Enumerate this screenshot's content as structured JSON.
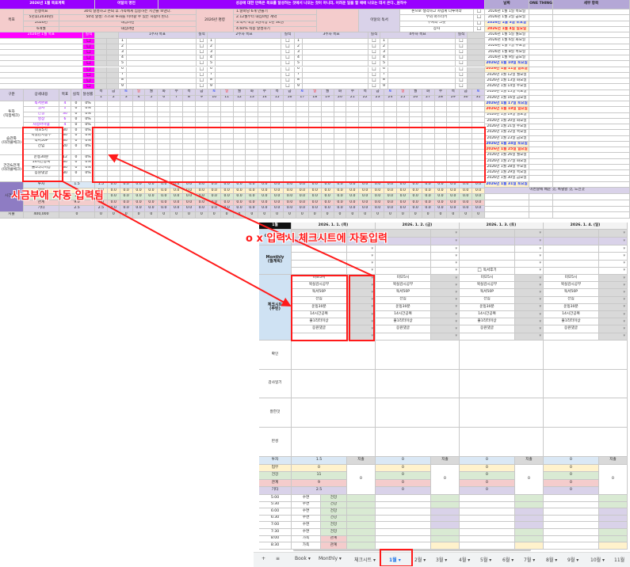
{
  "header": {
    "title": "2026년 1월 목표계획",
    "quote_label": "이달의 명언",
    "quote": "성공에 대한 만족은 목표를 달성하는 것에서 나오는 것이 아니라, 어려운 일을 할 때에 나오는 데서 온다._원작수"
  },
  "goals": {
    "label": "목표",
    "rows": [
      {
        "label": "인생목표",
        "value": "30억 달성하고 은퇴 후 가족에게 집중하는 시간을 보낸다."
      },
      {
        "label": "5년후(2030년)",
        "value": "50억 달성: 스스로 투자를 이어갈 수 있는 사람이 된다."
      },
      {
        "label": "2026년",
        "value": "내집마련"
      },
      {
        "label": "6개월",
        "value": "내집마련"
      }
    ],
    "command_label": "2026년 명령",
    "commands": [
      "1.달마당 6개 만들기",
      "2.12월부터 내집마련 계약",
      "3.독서 책발 3권이상 1년 36권",
      "4.60% 적용 달성하기"
    ],
    "reading_label": "이달의 독서",
    "books": [
      "돈으로 생각하고 사업계 다루어라",
      "부의 마스터키",
      "부자의 그릇",
      "장사"
    ]
  },
  "weekly": {
    "month_goal_label": "2026년 1월 목표",
    "result_label": "실적",
    "weeks": [
      "1주차 목표",
      "2주차 목표",
      "3주차 목표",
      "4주차 목표"
    ],
    "numbers": [
      "1",
      "2",
      "3",
      "4",
      "5",
      "6",
      "7",
      "8",
      "9"
    ]
  },
  "tracker": {
    "headers": [
      "구분",
      "상세내용",
      "목표",
      "실적",
      "달성률"
    ],
    "dow": [
      "목",
      "금",
      "토",
      "일",
      "월",
      "화",
      "수",
      "목",
      "금",
      "토",
      "일",
      "월",
      "화",
      "수",
      "목",
      "금",
      "토",
      "일",
      "월",
      "화",
      "수",
      "목",
      "금",
      "토",
      "일",
      "월",
      "화",
      "수",
      "목",
      "금",
      "토"
    ],
    "days": [
      "1",
      "2",
      "3",
      "4",
      "5",
      "6",
      "7",
      "8",
      "9",
      "10",
      "11",
      "12",
      "13",
      "14",
      "15",
      "16",
      "17",
      "18",
      "19",
      "20",
      "21",
      "22",
      "23",
      "24",
      "25",
      "26",
      "27",
      "28",
      "29",
      "30",
      "31"
    ],
    "groups": [
      {
        "label": "투자\n(직접체크)",
        "items": [
          {
            "name": "독서완료",
            "goal": "4",
            "actual": "0",
            "rate": "0%"
          },
          {
            "name": "필사",
            "goal": "1",
            "actual": "0",
            "rate": "0%"
          },
          {
            "name": "연필",
            "goal": "30",
            "actual": "0",
            "rate": "0%"
          },
          {
            "name": "영상",
            "goal": "6",
            "actual": "0",
            "rate": "0%"
          },
          {
            "name": "사업아이템",
            "goal": "4",
            "actual": "0",
            "rate": "0%"
          }
        ]
      },
      {
        "label": "습관화\n(미라클체크)",
        "items": [
          {
            "name": "미모5시",
            "goal": "30",
            "actual": "0",
            "rate": "0%"
          },
          {
            "name": "묵실감시공부",
            "goal": "30",
            "actual": "0",
            "rate": "0%"
          },
          {
            "name": "독서50P",
            "goal": "30",
            "actual": "0",
            "rate": "0%"
          },
          {
            "name": "전임",
            "goal": "20",
            "actual": "0",
            "rate": "0%"
          }
        ]
      },
      {
        "label": "건강&관계\n(미라클체크)",
        "items": [
          {
            "name": "운동30분",
            "goal": "12",
            "actual": "0",
            "rate": "0%"
          },
          {
            "name": "14시간공복",
            "goal": "30",
            "actual": "0",
            "rate": "0%"
          },
          {
            "name": "물1리터이상",
            "goal": "30",
            "actual": "0",
            "rate": "0%"
          },
          {
            "name": "응원댓글",
            "goal": "30",
            "actual": "0",
            "rate": "0%"
          }
        ]
      }
    ]
  },
  "summary": {
    "label": "시간관리",
    "rows": [
      {
        "label": "투자",
        "total": "1.5",
        "daily": [
          "1.5",
          "0.0",
          "0.0",
          "0.0",
          "0.0",
          "0.0",
          "0.0",
          "0.0",
          "0.0",
          "0.0",
          "0.0",
          "0.0",
          "0.0",
          "0.0",
          "0.0",
          "0.0",
          "0.0",
          "0.0",
          "0.0",
          "0.0",
          "0.0",
          "0.0",
          "0.0",
          "0.0",
          "0.0",
          "0.0",
          "0.0",
          "0.0",
          "0.0",
          "0.0",
          "0.0"
        ]
      },
      {
        "label": "업무",
        "total": "0",
        "daily": [
          "0.0",
          "0.0",
          "0.0",
          "0.0",
          "0.0",
          "0.0",
          "0.0",
          "0.0",
          "0.0",
          "0.0",
          "0.0",
          "0.0",
          "0.0",
          "0.0",
          "0.0",
          "0.0",
          "0.0",
          "0.0",
          "0.0",
          "0.0",
          "0.0",
          "0.0",
          "0.0",
          "0.0",
          "0.0",
          "0.0",
          "0.0",
          "0.0",
          "0.0",
          "0.0",
          "0.0"
        ]
      },
      {
        "label": "건강",
        "total": "11",
        "daily": [
          "11",
          "0.0",
          "0.0",
          "0.0",
          "0.0",
          "0.0",
          "0.0",
          "0.0",
          "0.0",
          "0.0",
          "0.0",
          "0.0",
          "0.0",
          "0.0",
          "0.0",
          "0.0",
          "0.0",
          "0.0",
          "0.0",
          "0.0",
          "0.0",
          "0.0",
          "0.0",
          "0.0",
          "0.0",
          "0.0",
          "0.0",
          "0.0",
          "0.0",
          "0.0",
          "0.0"
        ]
      },
      {
        "label": "관계",
        "total": "9.0",
        "daily": [
          "9.0",
          "0.0",
          "0.0",
          "0.0",
          "0.0",
          "0.0",
          "0.0",
          "0.0",
          "0.0",
          "0.0",
          "0.0",
          "0.0",
          "0.0",
          "0.0",
          "0.0",
          "0.0",
          "0.0",
          "0.0",
          "0.0",
          "0.0",
          "0.0",
          "0.0",
          "0.0",
          "0.0",
          "0.0",
          "0.0",
          "0.0",
          "0.0",
          "0.0",
          "0.0",
          "0.0"
        ]
      },
      {
        "label": "기타",
        "total": "2.5",
        "daily": [
          "2.5",
          "0.0",
          "0.0",
          "0.0",
          "0.0",
          "0.0",
          "0.0",
          "0.0",
          "0.0",
          "0.0",
          "0.0",
          "0.0",
          "0.0",
          "0.0",
          "0.0",
          "0.0",
          "0.0",
          "0.0",
          "0.0",
          "0.0",
          "0.0",
          "0.0",
          "0.0",
          "0.0",
          "0.0",
          "0.0",
          "0.0",
          "0.0",
          "0.0",
          "0.0",
          "0.0"
        ]
      }
    ],
    "expense": {
      "label": "지출",
      "amount": "400,000",
      "total": "0",
      "daily": [
        "0",
        "0",
        "0",
        "0",
        "0",
        "0",
        "0",
        "0",
        "0",
        "0",
        "0",
        "0",
        "0",
        "0",
        "0",
        "0",
        "0",
        "0",
        "0",
        "0",
        "0",
        "0",
        "0",
        "0",
        "0",
        "0",
        "0",
        "0",
        "0",
        "0",
        "0"
      ]
    }
  },
  "date_list": {
    "headers": [
      "날짜",
      "ONE THING",
      "세부 항목"
    ],
    "footer": "이번달에 배운 것, 특별할 것, 느낀것",
    "dates": [
      "2026년 1월 1일 목요일",
      "2026년 1월 2일 금요일",
      "2026년 1월 3일 토요일",
      "2026년 1월 4일 일요일",
      "2026년 1월 5일 월요일",
      "2026년 1월 6일 화요일",
      "2026년 1월 7일 수요일",
      "2026년 1월 8일 목요일",
      "2026년 1월 9일 금요일",
      "2026년 1월 10일 토요일",
      "2026년 1월 11일 일요일",
      "2026년 1월 12일 월요일",
      "2026년 1월 13일 화요일",
      "2026년 1월 14일 수요일",
      "2026년 1월 15일 목요일",
      "2026년 1월 16일 금요일",
      "2026년 1월 17일 토요일",
      "2026년 1월 18일 일요일",
      "2026년 1월 19일 월요일",
      "2026년 1월 20일 화요일",
      "2026년 1월 21일 수요일",
      "2026년 1월 22일 목요일",
      "2026년 1월 23일 금요일",
      "2026년 1월 24일 토요일",
      "2026년 1월 25일 일요일",
      "2026년 1월 26일 월요일",
      "2026년 1월 27일 화요일",
      "2026년 1월 28일 수요일",
      "2026년 1월 29일 목요일",
      "2026년 1월 30일 금요일",
      "2026년 1월 31일 토요일"
    ]
  },
  "daily_sheet": {
    "month": "1월",
    "labels": {
      "one_thing": "One Thing",
      "monthly": "Monthly\n(월계획)",
      "checksheet": "체크시트\n(루틴)",
      "confirm": "확인",
      "gratitude": "감사일기",
      "well_done": "잘한것",
      "reflection": "반성"
    },
    "routine": [
      "미모5시",
      "묵실감시공부",
      "독서50P",
      "전임",
      "운동30분",
      "14시간공복",
      "물1리터이상",
      "응원댓글"
    ],
    "monthly_plan_item": "한달계획",
    "reading_review_item": "독서후기",
    "summary_labels": [
      "투자",
      "업무",
      "건강",
      "관계",
      "기타"
    ],
    "expense_label": "지출",
    "days": [
      {
        "date": "2026. 1. 1. (목)",
        "summary": [
          "1.5",
          "0",
          "11",
          "9",
          "2.5"
        ],
        "expense": "0"
      },
      {
        "date": "2026. 1. 2. (금)",
        "summary": [
          "0",
          "0",
          "0",
          "0",
          "0"
        ],
        "expense": "0"
      },
      {
        "date": "2026. 1. 3. (토)",
        "summary": [
          "0",
          "0",
          "0",
          "0",
          "0"
        ],
        "expense": "0"
      },
      {
        "date": "2026. 1. 4. (일)",
        "summary": [
          "0",
          "0",
          "0",
          "0",
          "0"
        ],
        "expense": "0"
      }
    ],
    "times": [
      {
        "time": "5:00",
        "activity": "수면",
        "category": "건강"
      },
      {
        "time": "5:30",
        "activity": "수면",
        "category": "건강"
      },
      {
        "time": "6:00",
        "activity": "수면",
        "category": "건강"
      },
      {
        "time": "6:30",
        "activity": "수면",
        "category": "건강"
      },
      {
        "time": "7:00",
        "activity": "수면",
        "category": "건강"
      },
      {
        "time": "7:30",
        "activity": "수면",
        "category": "건강"
      },
      {
        "time": "8:00",
        "activity": "가족",
        "category": "관계"
      },
      {
        "time": "8:30",
        "activity": "가족",
        "category": "관계"
      }
    ]
  },
  "tabs": {
    "add": "+",
    "menu": "≡",
    "items": [
      "Book ▾",
      "Monthly ▾",
      "체크시트 ▾",
      "1월 ▾",
      "2월 ▾",
      "3월 ▾",
      "4월 ▾",
      "5월 ▾",
      "6월 ▾",
      "7월 ▾",
      "8월 ▾",
      "9월 ▾",
      "10월 ▾",
      "11월"
    ],
    "active": 3
  },
  "annotations": {
    "left": "시금부에 자동 입력됨",
    "right": "o x 입력시 체크시트에 자동입력"
  },
  "colors": {
    "accent": "#9900ff",
    "magenta": "#ff00ff",
    "annotation": "#ff1a1a"
  }
}
